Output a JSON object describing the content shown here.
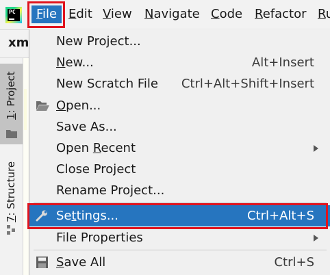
{
  "menubar": {
    "items": [
      {
        "pre": "",
        "u": "F",
        "post": "ile"
      },
      {
        "pre": "",
        "u": "E",
        "post": "dit"
      },
      {
        "pre": "",
        "u": "V",
        "post": "iew"
      },
      {
        "pre": "",
        "u": "N",
        "post": "avigate"
      },
      {
        "pre": "",
        "u": "C",
        "post": "ode"
      },
      {
        "pre": "",
        "u": "R",
        "post": "efactor"
      },
      {
        "pre": "",
        "u": "R",
        "post": "u"
      }
    ],
    "active_index": 0
  },
  "editor": {
    "tab_text": "xm"
  },
  "tool_windows": {
    "project": {
      "u": "1",
      "post": ": Project"
    },
    "structure": {
      "u": "7",
      "post": ": Structure"
    }
  },
  "file_menu": {
    "items": [
      {
        "pre": "New Project...",
        "u": "",
        "post": "",
        "shortcut": ""
      },
      {
        "pre": "",
        "u": "N",
        "post": "ew...",
        "shortcut": "Alt+Insert"
      },
      {
        "pre": "New Scratch File",
        "u": "",
        "post": "",
        "shortcut": "Ctrl+Alt+Shift+Insert"
      },
      {
        "pre": "",
        "u": "O",
        "post": "pen...",
        "shortcut": ""
      },
      {
        "pre": "Save As...",
        "u": "",
        "post": "",
        "shortcut": ""
      },
      {
        "pre": "Open ",
        "u": "R",
        "post": "ecent",
        "shortcut": ""
      },
      {
        "pre": "Close Project",
        "u": "",
        "post": "",
        "shortcut": ""
      },
      {
        "pre": "Rename Project...",
        "u": "",
        "post": "",
        "shortcut": ""
      },
      {
        "pre": "Se",
        "u": "t",
        "post": "tings...",
        "shortcut": "Ctrl+Alt+S"
      },
      {
        "pre": "File Properties",
        "u": "",
        "post": "",
        "shortcut": ""
      },
      {
        "pre": "",
        "u": "S",
        "post": "ave All",
        "shortcut": "Ctrl+S"
      }
    ],
    "selected_index": 8
  },
  "colors": {
    "selection_blue": "#2675bf",
    "highlight_red": "#e0141e"
  },
  "icons": {
    "open": "folder-open-icon",
    "settings": "wrench-icon",
    "save_all": "floppy-disk-icon",
    "submenu": "chevron-right-icon"
  }
}
